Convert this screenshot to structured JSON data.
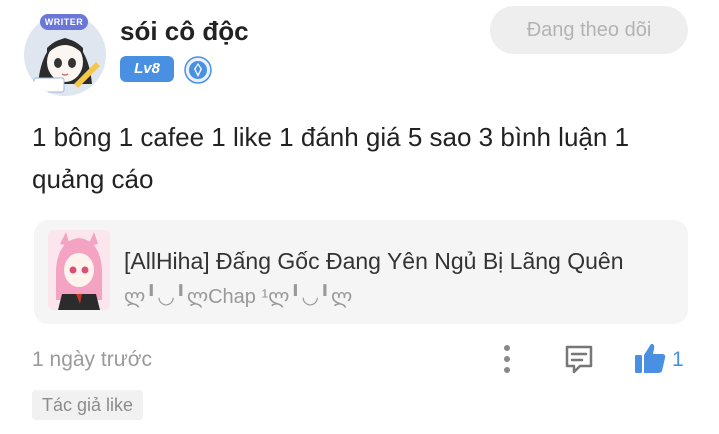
{
  "comment": {
    "user": {
      "name": "sói cô độc",
      "level": "Lv8",
      "writer_badge": "WRITER"
    },
    "follow_button_label": "Đang theo dõi",
    "text": "1 bông 1 cafee 1 like 1 đánh giá 5 sao 3 bình luận 1 quảng cáo",
    "manga": {
      "title": "[AllHiha] Đấng Gốc Đang Yên Ngủ Bị Lãng Quên",
      "chapter": "ლ╹◡╹ლChap ¹ლ╹◡╹ლ"
    },
    "timestamp": "1 ngày trước",
    "like_count": "1",
    "author_like_tag": "Tác giả like"
  },
  "colors": {
    "accent": "#4a90e2",
    "level_badge": "#4a90e2",
    "follow_bg": "#eeeeee",
    "follow_text": "#b3b3b3",
    "card_bg": "#f5f5f5",
    "muted_text": "#9a9a9a"
  },
  "icons": [
    "avatar",
    "diamond-rank-icon",
    "more-vertical-icon",
    "reply-comment-icon",
    "thumbs-up-icon"
  ]
}
